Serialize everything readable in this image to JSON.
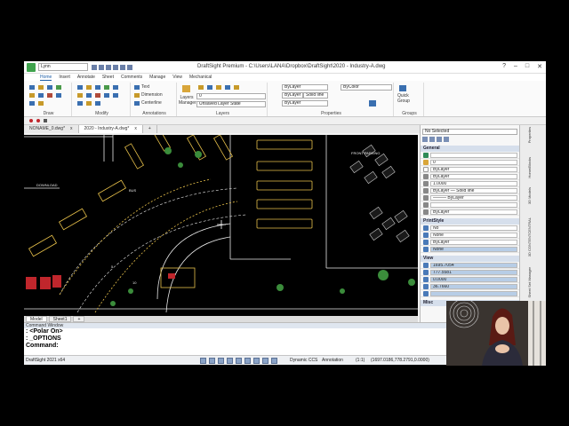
{
  "app": {
    "workspace": "Lynn",
    "title": "DraftSight Premium - C:\\Users\\LANA\\Dropbox\\DraftSight\\2020 - Industry-A.dwg",
    "window_controls": [
      "–",
      "□",
      "✕"
    ],
    "help": "?"
  },
  "menu_tabs": [
    "Home",
    "Insert",
    "Annotate",
    "Sheet",
    "Comments",
    "Manage",
    "View",
    "Mechanical"
  ],
  "ribbon": {
    "groups": [
      "Draw",
      "Modify",
      "Annotations",
      "Layers",
      "Properties",
      "Groups"
    ],
    "annotations": {
      "text": "Text",
      "dimension": "Dimension",
      "centerline": "Centerline"
    },
    "layers": {
      "manager_label": "Layers Manager",
      "current_layer": "0",
      "layer_state": "Unsaved Layer State"
    },
    "properties": {
      "color": "ByLayer",
      "bycolor": "ByColor",
      "line_weight": "ByLayer",
      "linestyle": "Solid line",
      "line_style2": "ByLayer"
    },
    "groups_panel": {
      "quick_group": "Quick Group"
    }
  },
  "doc_tabs": [
    {
      "label": "NONAME_0.dwg*",
      "close": "x"
    },
    {
      "label": "2020 - Industry-A.dwg*",
      "close": "x"
    },
    {
      "label": "+"
    }
  ],
  "model_tabs": [
    "Model",
    "Sheet1",
    "+"
  ],
  "command_window": {
    "header": "Command Window",
    "lines": [
      ": <Polar On>",
      ": _OPTIONS"
    ],
    "prompt": "Command:"
  },
  "status_bar": {
    "version": "DraftSight 2021 x64",
    "dynamic_ccs": "Dynamic CCS",
    "annotation": "Annotation",
    "scale": "(1:1)",
    "coords": "(1697.0186,778.2791,0.0000)"
  },
  "properties_panel": {
    "selection": "No Selected",
    "sections": [
      {
        "title": "General",
        "rows": [
          {
            "icon": "color-swatch-icon",
            "value": "",
            "highlight": false
          },
          {
            "icon": "layer-icon",
            "value": "0",
            "highlight": false
          },
          {
            "icon": "bylayer-icon",
            "value": "ByLayer",
            "highlight": false
          },
          {
            "icon": "linestyle-icon",
            "value": "ByLayer",
            "highlight": false
          },
          {
            "icon": "scale-icon",
            "value": "1.0000",
            "highlight": false
          },
          {
            "icon": "line-icon",
            "value": "ByLayer  —  Solid line",
            "highlight": false
          },
          {
            "icon": "weight-icon",
            "value": "——— ByLayer",
            "highlight": false
          },
          {
            "icon": "transparency-icon",
            "value": "",
            "highlight": false
          },
          {
            "icon": "print-icon",
            "value": "ByLayer",
            "highlight": false
          }
        ]
      },
      {
        "title": "PrintStyle",
        "rows": [
          {
            "icon": "print-style-icon",
            "value": "No",
            "highlight": false
          },
          {
            "icon": "print-style-icon-2",
            "value": "None",
            "highlight": false
          },
          {
            "icon": "print-style-icon-3",
            "value": "ByLayer",
            "highlight": false
          },
          {
            "icon": "print-style-icon-4",
            "value": "None",
            "highlight": true
          }
        ]
      },
      {
        "title": "View",
        "rows": [
          {
            "icon": "center-x-icon",
            "value": "1695.7054",
            "highlight": true
          },
          {
            "icon": "center-y-icon",
            "value": "777.5581",
            "highlight": true
          },
          {
            "icon": "center-z-icon",
            "value": "0.0000",
            "highlight": true
          },
          {
            "icon": "height-icon",
            "value": "36.7660",
            "highlight": true
          },
          {
            "icon": "width-icon",
            "value": "",
            "highlight": true
          }
        ]
      },
      {
        "title": "Misc",
        "rows": []
      }
    ]
  },
  "side_tabs": [
    "Properties",
    "Home/Blocks",
    "3D Models",
    "3D CONTENTCENTRAL",
    "Sheet Set Manager"
  ],
  "canvas_labels": [
    "DOWNLOAD",
    "BUS",
    "FRONT PARKING",
    "5",
    "10"
  ],
  "colors": {
    "accent": "#1f5fa8",
    "canvas": "#000000",
    "highlight": "#b7cde6",
    "section": "#d6dfec",
    "cad_yellow": "#e8c14a",
    "cad_white": "#e8e8e8",
    "cad_green": "#3b8c3b",
    "cad_red": "#c0262c"
  }
}
